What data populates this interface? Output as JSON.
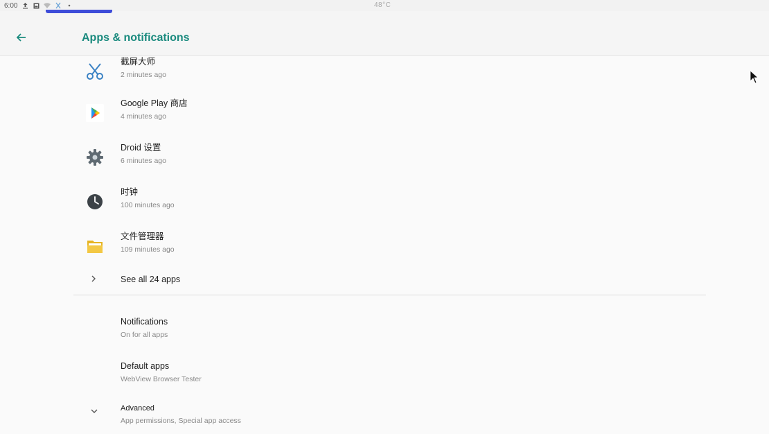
{
  "status_bar": {
    "time": "6:00",
    "temperature": "48°C",
    "icons": [
      "upload-icon",
      "photo-icon",
      "wifi-icon",
      "scissors-icon",
      "dot-icon"
    ]
  },
  "app_bar": {
    "title": "Apps & notifications",
    "back_icon": "back-arrow-icon"
  },
  "recent_apps": [
    {
      "name": "截屏大师",
      "time": "2 minutes ago",
      "icon": "scissors-icon"
    },
    {
      "name": "Google Play 商店",
      "time": "4 minutes ago",
      "icon": "play-store-icon"
    },
    {
      "name": "Droid 设置",
      "time": "6 minutes ago",
      "icon": "settings-gear-icon"
    },
    {
      "name": "时钟",
      "time": "100 minutes ago",
      "icon": "clock-icon"
    },
    {
      "name": "文件管理器",
      "time": "109 minutes ago",
      "icon": "folder-icon"
    }
  ],
  "see_all": {
    "label": "See all 24 apps"
  },
  "settings": [
    {
      "title": "Notifications",
      "subtitle": "On for all apps"
    },
    {
      "title": "Default apps",
      "subtitle": "WebView Browser Tester"
    },
    {
      "title": "Advanced",
      "subtitle": "App permissions, Special app access"
    }
  ],
  "colors": {
    "accent": "#1a8a7e",
    "background": "#fafafa"
  }
}
